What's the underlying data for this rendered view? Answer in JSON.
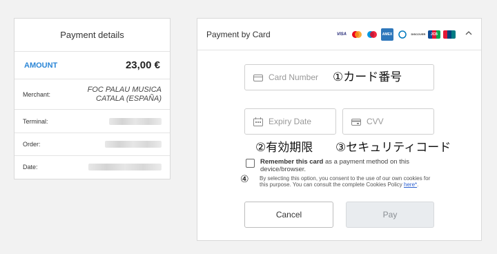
{
  "details": {
    "title": "Payment details",
    "amount_label": "AMOUNT",
    "amount_value": "23,00 €",
    "merchant_label": "Merchant:",
    "merchant_value": "FOC PALAU MUSICA CATALA (ESPAÑA)",
    "terminal_label": "Terminal:",
    "order_label": "Order:",
    "date_label": "Date:"
  },
  "card": {
    "title": "Payment by Card",
    "brands": [
      "VISA",
      "MC",
      "MC",
      "AMEX",
      "DINERS",
      "DISCOVER",
      "JCB",
      "UNIONPAY"
    ],
    "card_number_placeholder": "Card Number",
    "expiry_placeholder": "Expiry Date",
    "cvv_placeholder": "CVV",
    "remember_bold": "Remember this card",
    "remember_rest": " as a payment method on this device/browser.",
    "consent_text": "By selecting this option, you consent to the use of our own cookies for this purpose. You can consult the complete Cookies Policy ",
    "consent_link": "here*",
    "consent_end": ".",
    "cancel_label": "Cancel",
    "pay_label": "Pay"
  },
  "annotations": {
    "a1": "①カード番号",
    "a2": "②有効期限",
    "a3": "③セキュリティコード",
    "a4": "④"
  },
  "colors": {
    "accent": "#2b86d6",
    "link": "#2b5fcf",
    "pay_disabled_bg": "#e9ecef"
  }
}
